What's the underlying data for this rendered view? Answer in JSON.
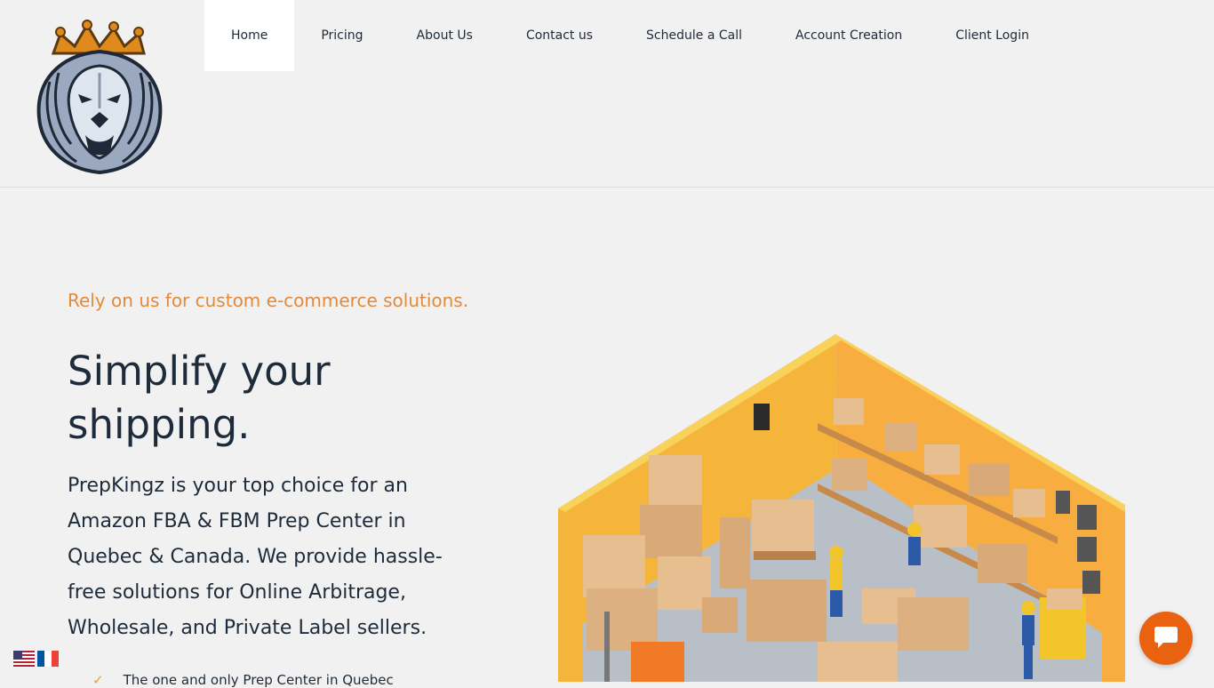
{
  "nav": {
    "items": [
      {
        "label": "Home",
        "active": true
      },
      {
        "label": "Pricing"
      },
      {
        "label": "About Us"
      },
      {
        "label": "Contact us"
      },
      {
        "label": "Schedule a Call"
      },
      {
        "label": "Account Creation"
      },
      {
        "label": "Client Login"
      }
    ]
  },
  "logo": {
    "icon": "lion-crown-logo"
  },
  "hero": {
    "eyebrow": "Rely on us for custom e-commerce solutions.",
    "headline": "Simplify your shipping.",
    "lead": "PrepKingz is your top choice for an Amazon FBA & FBM Prep Center in Quebec & Canada. We provide hassle-free solutions for Online Arbitrage, Wholesale, and Private Label sellers.",
    "bullet": "The one and only Prep Center in Quebec",
    "image": "warehouse-illustration"
  },
  "language": {
    "options": [
      "us-flag",
      "fr-flag"
    ]
  },
  "chat": {
    "icon": "chat-bubble-icon"
  },
  "colors": {
    "accent": "#e38a3a",
    "chat": "#e8620f",
    "text": "#1e2b3a",
    "background": "#f1f1f1"
  }
}
